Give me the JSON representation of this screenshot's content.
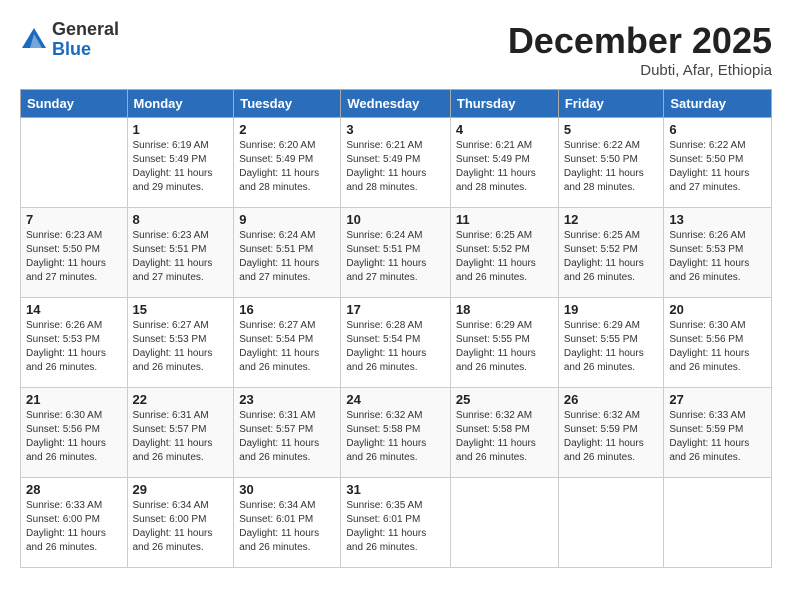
{
  "header": {
    "logo_general": "General",
    "logo_blue": "Blue",
    "month_title": "December 2025",
    "subtitle": "Dubti, Afar, Ethiopia"
  },
  "weekdays": [
    "Sunday",
    "Monday",
    "Tuesday",
    "Wednesday",
    "Thursday",
    "Friday",
    "Saturday"
  ],
  "weeks": [
    [
      {
        "day": "",
        "sunrise": "",
        "sunset": "",
        "daylight": "",
        "empty": true
      },
      {
        "day": "1",
        "sunrise": "Sunrise: 6:19 AM",
        "sunset": "Sunset: 5:49 PM",
        "daylight": "Daylight: 11 hours and 29 minutes."
      },
      {
        "day": "2",
        "sunrise": "Sunrise: 6:20 AM",
        "sunset": "Sunset: 5:49 PM",
        "daylight": "Daylight: 11 hours and 28 minutes."
      },
      {
        "day": "3",
        "sunrise": "Sunrise: 6:21 AM",
        "sunset": "Sunset: 5:49 PM",
        "daylight": "Daylight: 11 hours and 28 minutes."
      },
      {
        "day": "4",
        "sunrise": "Sunrise: 6:21 AM",
        "sunset": "Sunset: 5:49 PM",
        "daylight": "Daylight: 11 hours and 28 minutes."
      },
      {
        "day": "5",
        "sunrise": "Sunrise: 6:22 AM",
        "sunset": "Sunset: 5:50 PM",
        "daylight": "Daylight: 11 hours and 28 minutes."
      },
      {
        "day": "6",
        "sunrise": "Sunrise: 6:22 AM",
        "sunset": "Sunset: 5:50 PM",
        "daylight": "Daylight: 11 hours and 27 minutes."
      }
    ],
    [
      {
        "day": "7",
        "sunrise": "Sunrise: 6:23 AM",
        "sunset": "Sunset: 5:50 PM",
        "daylight": "Daylight: 11 hours and 27 minutes."
      },
      {
        "day": "8",
        "sunrise": "Sunrise: 6:23 AM",
        "sunset": "Sunset: 5:51 PM",
        "daylight": "Daylight: 11 hours and 27 minutes."
      },
      {
        "day": "9",
        "sunrise": "Sunrise: 6:24 AM",
        "sunset": "Sunset: 5:51 PM",
        "daylight": "Daylight: 11 hours and 27 minutes."
      },
      {
        "day": "10",
        "sunrise": "Sunrise: 6:24 AM",
        "sunset": "Sunset: 5:51 PM",
        "daylight": "Daylight: 11 hours and 27 minutes."
      },
      {
        "day": "11",
        "sunrise": "Sunrise: 6:25 AM",
        "sunset": "Sunset: 5:52 PM",
        "daylight": "Daylight: 11 hours and 26 minutes."
      },
      {
        "day": "12",
        "sunrise": "Sunrise: 6:25 AM",
        "sunset": "Sunset: 5:52 PM",
        "daylight": "Daylight: 11 hours and 26 minutes."
      },
      {
        "day": "13",
        "sunrise": "Sunrise: 6:26 AM",
        "sunset": "Sunset: 5:53 PM",
        "daylight": "Daylight: 11 hours and 26 minutes."
      }
    ],
    [
      {
        "day": "14",
        "sunrise": "Sunrise: 6:26 AM",
        "sunset": "Sunset: 5:53 PM",
        "daylight": "Daylight: 11 hours and 26 minutes."
      },
      {
        "day": "15",
        "sunrise": "Sunrise: 6:27 AM",
        "sunset": "Sunset: 5:53 PM",
        "daylight": "Daylight: 11 hours and 26 minutes."
      },
      {
        "day": "16",
        "sunrise": "Sunrise: 6:27 AM",
        "sunset": "Sunset: 5:54 PM",
        "daylight": "Daylight: 11 hours and 26 minutes."
      },
      {
        "day": "17",
        "sunrise": "Sunrise: 6:28 AM",
        "sunset": "Sunset: 5:54 PM",
        "daylight": "Daylight: 11 hours and 26 minutes."
      },
      {
        "day": "18",
        "sunrise": "Sunrise: 6:29 AM",
        "sunset": "Sunset: 5:55 PM",
        "daylight": "Daylight: 11 hours and 26 minutes."
      },
      {
        "day": "19",
        "sunrise": "Sunrise: 6:29 AM",
        "sunset": "Sunset: 5:55 PM",
        "daylight": "Daylight: 11 hours and 26 minutes."
      },
      {
        "day": "20",
        "sunrise": "Sunrise: 6:30 AM",
        "sunset": "Sunset: 5:56 PM",
        "daylight": "Daylight: 11 hours and 26 minutes."
      }
    ],
    [
      {
        "day": "21",
        "sunrise": "Sunrise: 6:30 AM",
        "sunset": "Sunset: 5:56 PM",
        "daylight": "Daylight: 11 hours and 26 minutes."
      },
      {
        "day": "22",
        "sunrise": "Sunrise: 6:31 AM",
        "sunset": "Sunset: 5:57 PM",
        "daylight": "Daylight: 11 hours and 26 minutes."
      },
      {
        "day": "23",
        "sunrise": "Sunrise: 6:31 AM",
        "sunset": "Sunset: 5:57 PM",
        "daylight": "Daylight: 11 hours and 26 minutes."
      },
      {
        "day": "24",
        "sunrise": "Sunrise: 6:32 AM",
        "sunset": "Sunset: 5:58 PM",
        "daylight": "Daylight: 11 hours and 26 minutes."
      },
      {
        "day": "25",
        "sunrise": "Sunrise: 6:32 AM",
        "sunset": "Sunset: 5:58 PM",
        "daylight": "Daylight: 11 hours and 26 minutes."
      },
      {
        "day": "26",
        "sunrise": "Sunrise: 6:32 AM",
        "sunset": "Sunset: 5:59 PM",
        "daylight": "Daylight: 11 hours and 26 minutes."
      },
      {
        "day": "27",
        "sunrise": "Sunrise: 6:33 AM",
        "sunset": "Sunset: 5:59 PM",
        "daylight": "Daylight: 11 hours and 26 minutes."
      }
    ],
    [
      {
        "day": "28",
        "sunrise": "Sunrise: 6:33 AM",
        "sunset": "Sunset: 6:00 PM",
        "daylight": "Daylight: 11 hours and 26 minutes."
      },
      {
        "day": "29",
        "sunrise": "Sunrise: 6:34 AM",
        "sunset": "Sunset: 6:00 PM",
        "daylight": "Daylight: 11 hours and 26 minutes."
      },
      {
        "day": "30",
        "sunrise": "Sunrise: 6:34 AM",
        "sunset": "Sunset: 6:01 PM",
        "daylight": "Daylight: 11 hours and 26 minutes."
      },
      {
        "day": "31",
        "sunrise": "Sunrise: 6:35 AM",
        "sunset": "Sunset: 6:01 PM",
        "daylight": "Daylight: 11 hours and 26 minutes."
      },
      {
        "day": "",
        "sunrise": "",
        "sunset": "",
        "daylight": "",
        "empty": true
      },
      {
        "day": "",
        "sunrise": "",
        "sunset": "",
        "daylight": "",
        "empty": true
      },
      {
        "day": "",
        "sunrise": "",
        "sunset": "",
        "daylight": "",
        "empty": true
      }
    ]
  ]
}
